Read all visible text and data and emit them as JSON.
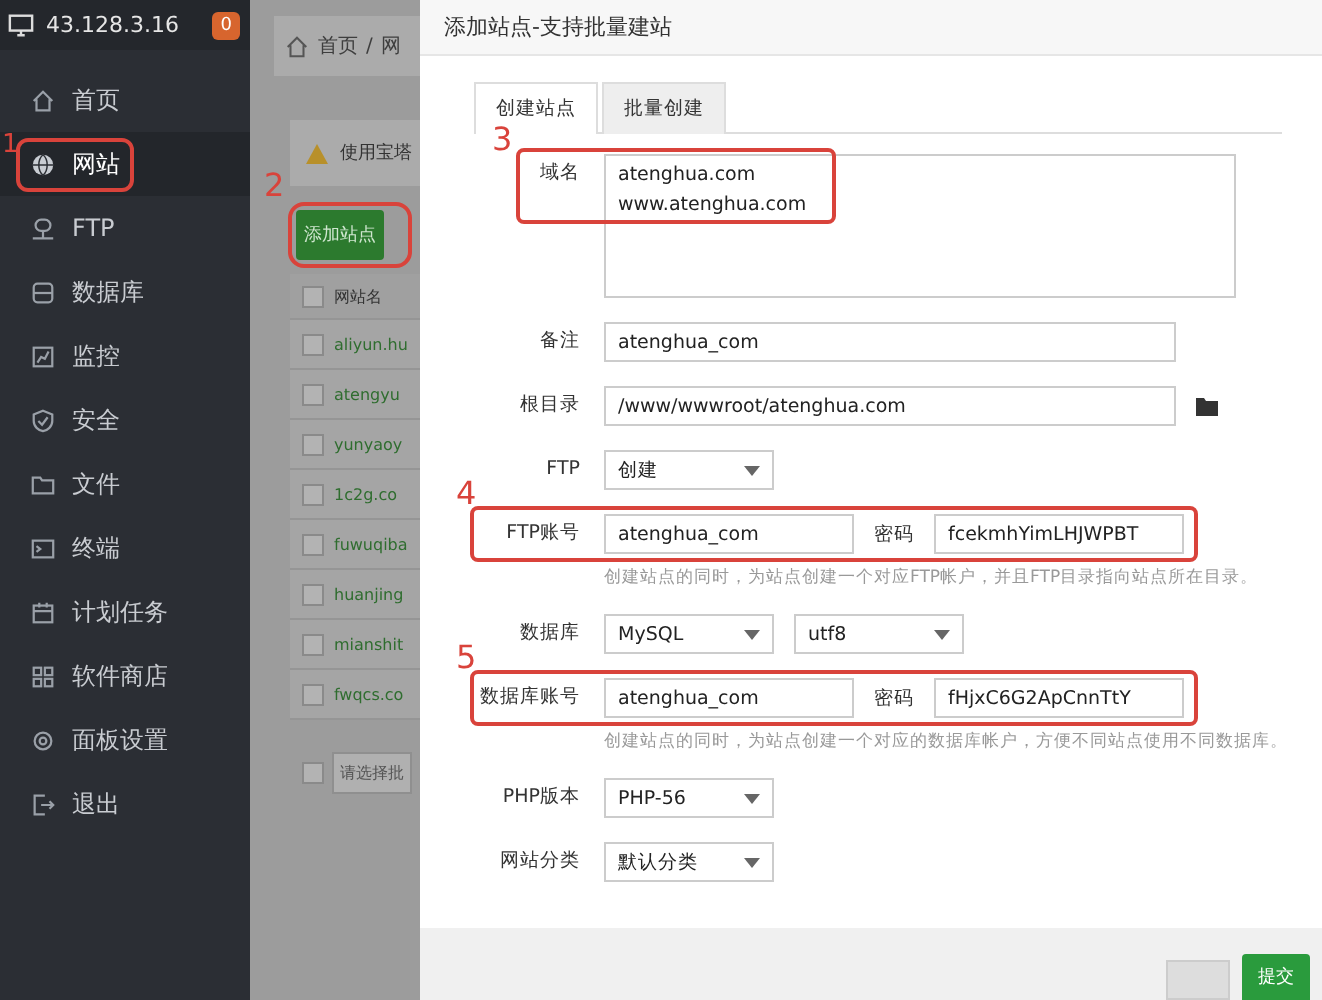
{
  "server": {
    "ip": "43.128.3.16",
    "badge": "0"
  },
  "sidebar": {
    "items": [
      {
        "label": "首页",
        "selected": false
      },
      {
        "label": "网站",
        "selected": true,
        "callout": "1"
      },
      {
        "label": "FTP",
        "selected": false
      },
      {
        "label": "数据库",
        "selected": false
      },
      {
        "label": "监控",
        "selected": false
      },
      {
        "label": "安全",
        "selected": false
      },
      {
        "label": "文件",
        "selected": false
      },
      {
        "label": "终端",
        "selected": false
      },
      {
        "label": "计划任务",
        "selected": false
      },
      {
        "label": "软件商店",
        "selected": false
      },
      {
        "label": "面板设置",
        "selected": false
      },
      {
        "label": "退出",
        "selected": false
      }
    ]
  },
  "background_page": {
    "breadcrumb": [
      "首页",
      "网"
    ],
    "breadcrumb_separator": "/",
    "header_checkbox": {
      "checked": false
    },
    "notice": "使用宝塔",
    "add_button": {
      "label": "添加站点",
      "callout": "2"
    },
    "table": {
      "columns": [
        "网站名"
      ],
      "rows": [
        {
          "name": "aliyun.hu",
          "checked": false
        },
        {
          "name": "atengyu",
          "checked": false
        },
        {
          "name": "yunyaoy",
          "checked": false
        },
        {
          "name": "1c2g.co",
          "checked": false
        },
        {
          "name": "fuwuqiba",
          "checked": false
        },
        {
          "name": "huanjing",
          "checked": false
        },
        {
          "name": "mianshit",
          "checked": false
        },
        {
          "name": "fwqcs.co",
          "checked": false
        }
      ]
    },
    "batch_select": {
      "placeholder": "请选择批",
      "checkbox_checked": false
    }
  },
  "dialog": {
    "title": "添加站点-支持批量建站",
    "tabs": [
      {
        "label": "创建站点",
        "selected": true
      },
      {
        "label": "批量创建",
        "selected": false
      }
    ],
    "fields": [
      {
        "kind": "textarea",
        "label": "域名",
        "values": [
          "atenghua.com",
          "www.atenghua.com"
        ],
        "callout": "3"
      },
      {
        "kind": "input",
        "label": "备注",
        "value": "atenghua_com"
      },
      {
        "kind": "path",
        "label": "根目录",
        "value": "/www/wwwroot/atenghua.com"
      },
      {
        "kind": "select",
        "label": "FTP",
        "value": "创建"
      },
      {
        "kind": "account",
        "label": "FTP账号",
        "value": "atenghua_com",
        "password_label": "密码",
        "password": "fcekmhYimLHJWPBT",
        "hint": "创建站点的同时，为站点创建一个对应FTP帐户，并且FTP目录指向站点所在目录。",
        "callout": "4"
      },
      {
        "kind": "select_pair",
        "label": "数据库",
        "value": "MySQL",
        "value_2": "utf8"
      },
      {
        "kind": "account",
        "label": "数据库账号",
        "value": "atenghua_com",
        "password_label": "密码",
        "password": "fHjxC6G2ApCnnTtY",
        "hint": "创建站点的同时，为站点创建一个对应的数据库帐户，方便不同站点使用不同数据库。",
        "callout": "5"
      },
      {
        "kind": "select",
        "label": "PHP版本",
        "value": "PHP-56"
      },
      {
        "kind": "select",
        "label": "网站分类",
        "value": "默认分类"
      }
    ],
    "buttons": [
      {
        "kind": "cancel"
      },
      {
        "kind": "submit",
        "label": "提交"
      }
    ]
  }
}
